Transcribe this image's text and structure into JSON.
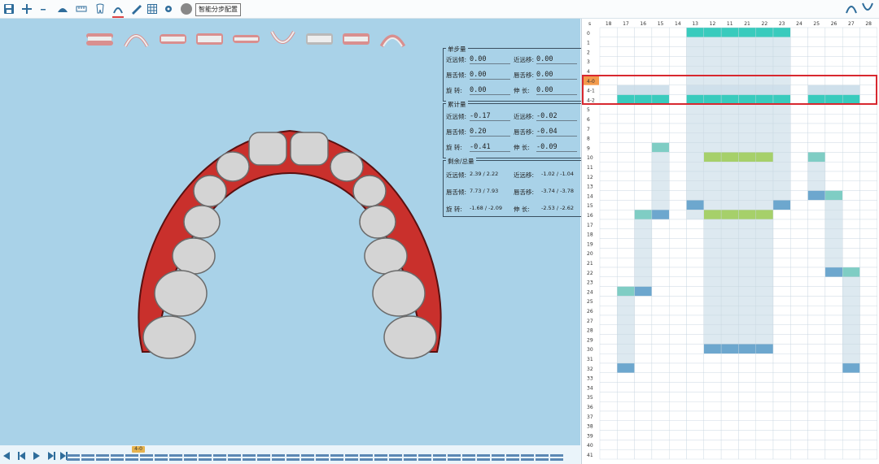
{
  "toolbar": {
    "smart_button": "智能分步配置",
    "icons": [
      "save-icon",
      "add-icon",
      "minus-icon",
      "teeth-view-icon",
      "ruler-icon",
      "tooth-icon",
      "arch-icon",
      "paint-icon",
      "grid-icon",
      "gear-icon",
      "circle-icon"
    ]
  },
  "panels": {
    "single_step": {
      "title": "单步量",
      "rows": [
        {
          "l1": "近远倾:",
          "v1": "0.00",
          "l2": "近远移:",
          "v2": "0.00"
        },
        {
          "l1": "唇舌倾:",
          "v1": "0.00",
          "l2": "唇舌移:",
          "v2": "0.00"
        },
        {
          "l1": "旋 转:",
          "v1": "0.00",
          "l2": "伸 长:",
          "v2": "0.00"
        }
      ]
    },
    "cumulative": {
      "title": "累计量",
      "rows": [
        {
          "l1": "近远倾:",
          "v1": "-0.17",
          "l2": "近远移:",
          "v2": "-0.02"
        },
        {
          "l1": "唇舌倾:",
          "v1": "0.20",
          "l2": "唇舌移:",
          "v2": "-0.04"
        },
        {
          "l1": "旋 转:",
          "v1": "-0.41",
          "l2": "伸 长:",
          "v2": "-0.09"
        }
      ]
    },
    "remaining": {
      "title": "剩余/总量",
      "rows": [
        {
          "l1": "近远倾:",
          "v1": "2.39 / 2.22",
          "l2": "近远移:",
          "v2": "-1.02 / -1.04"
        },
        {
          "l1": "唇舌倾:",
          "v1": "7.73 / 7.93",
          "l2": "唇舌移:",
          "v2": "-3.74 / -3.78"
        },
        {
          "l1": "旋 转:",
          "v1": "-1.68 / -2.09",
          "l2": "伸 长:",
          "v2": "-2.53 / -2.62"
        }
      ]
    }
  },
  "timeline": {
    "marker": "4-0"
  },
  "grid": {
    "corner": "s",
    "columns": [
      "18",
      "17",
      "16",
      "15",
      "14",
      "13",
      "12",
      "11",
      "21",
      "22",
      "23",
      "24",
      "25",
      "26",
      "27",
      "28"
    ],
    "rows": [
      "0",
      "1",
      "2",
      "3",
      "4",
      "4-0",
      "4-1",
      "4-2",
      "5",
      "6",
      "7",
      "8",
      "9",
      "10",
      "11",
      "12",
      "13",
      "14",
      "15",
      "16",
      "17",
      "18",
      "19",
      "20",
      "21",
      "22",
      "23",
      "24",
      "25",
      "26",
      "27",
      "28",
      "29",
      "30",
      "31",
      "32",
      "33",
      "34",
      "35",
      "36",
      "37",
      "38",
      "39",
      "40",
      "41"
    ],
    "highlight_row": "4-0",
    "colors": {
      "empty": "#ffffff",
      "light": "#dde9f0",
      "mid": "#cfe0eb",
      "teal": "#39cbbd",
      "green": "#a6d06a",
      "blue": "#6da7ce",
      "tealdark": "#7fcdc4",
      "highlight": "#f39a4c",
      "border": "#c8d6e0"
    }
  }
}
